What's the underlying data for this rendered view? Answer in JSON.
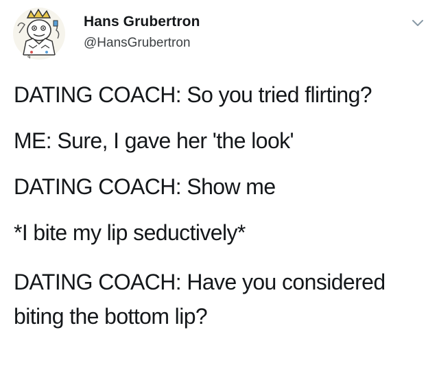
{
  "tweet": {
    "author": {
      "display_name": "Hans Grubertron",
      "handle": "@HansGrubertron",
      "avatar_icon": "cartoon-king-avatar"
    },
    "menu_icon": "chevron-down-icon",
    "lines": [
      "DATING COACH: So you tried flirting?",
      "ME: Sure, I gave her 'the look'",
      "DATING COACH: Show me",
      "*I bite my lip seductively*",
      "DATING COACH: Have you considered biting the bottom lip?"
    ]
  },
  "colors": {
    "text": "#14171a",
    "secondary_text": "#3c4043",
    "icon": "#8899a6",
    "background": "#ffffff"
  }
}
